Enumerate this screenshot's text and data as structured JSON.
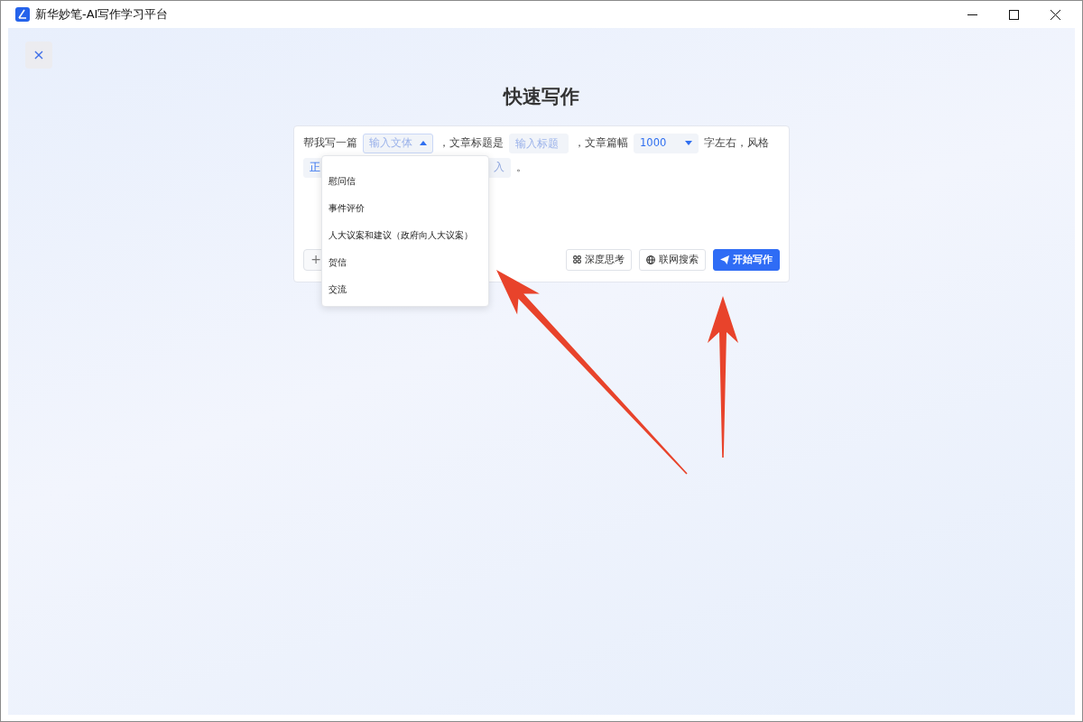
{
  "window": {
    "title": "新华妙笔-AI写作学习平台"
  },
  "close_label": "×",
  "page_title": "快速写作",
  "prompt": [
    {
      "kind": "text",
      "text": "帮我写一篇"
    },
    {
      "kind": "select",
      "placeholder": "输入文体",
      "open": true
    },
    {
      "kind": "text",
      "text": "，文章标题是"
    },
    {
      "kind": "input",
      "placeholder": "输入标题"
    },
    {
      "kind": "text",
      "text": "，文章篇幅"
    },
    {
      "kind": "select",
      "value": "1000",
      "open": false
    },
    {
      "kind": "text",
      "text": "字左右，风格"
    },
    {
      "kind": "cut",
      "value": "正",
      "tail": "入"
    },
    {
      "kind": "text",
      "text": "。"
    }
  ],
  "dropdown": {
    "options": [
      {
        "label": "慰问信"
      },
      {
        "label": "事件评价"
      },
      {
        "label": "人大议案和建议（政府向人大议案）"
      },
      {
        "label": "贺信"
      },
      {
        "label": "交流"
      }
    ]
  },
  "add_label": "+",
  "buttons": [
    {
      "label": "深度思考",
      "kind": "think",
      "primary": false
    },
    {
      "label": "联网搜索",
      "kind": "web",
      "primary": false
    },
    {
      "label": "开始写作",
      "kind": "send",
      "primary": true
    }
  ],
  "annotations": [
    {
      "kind": "arrow"
    },
    {
      "kind": "arrow"
    }
  ]
}
